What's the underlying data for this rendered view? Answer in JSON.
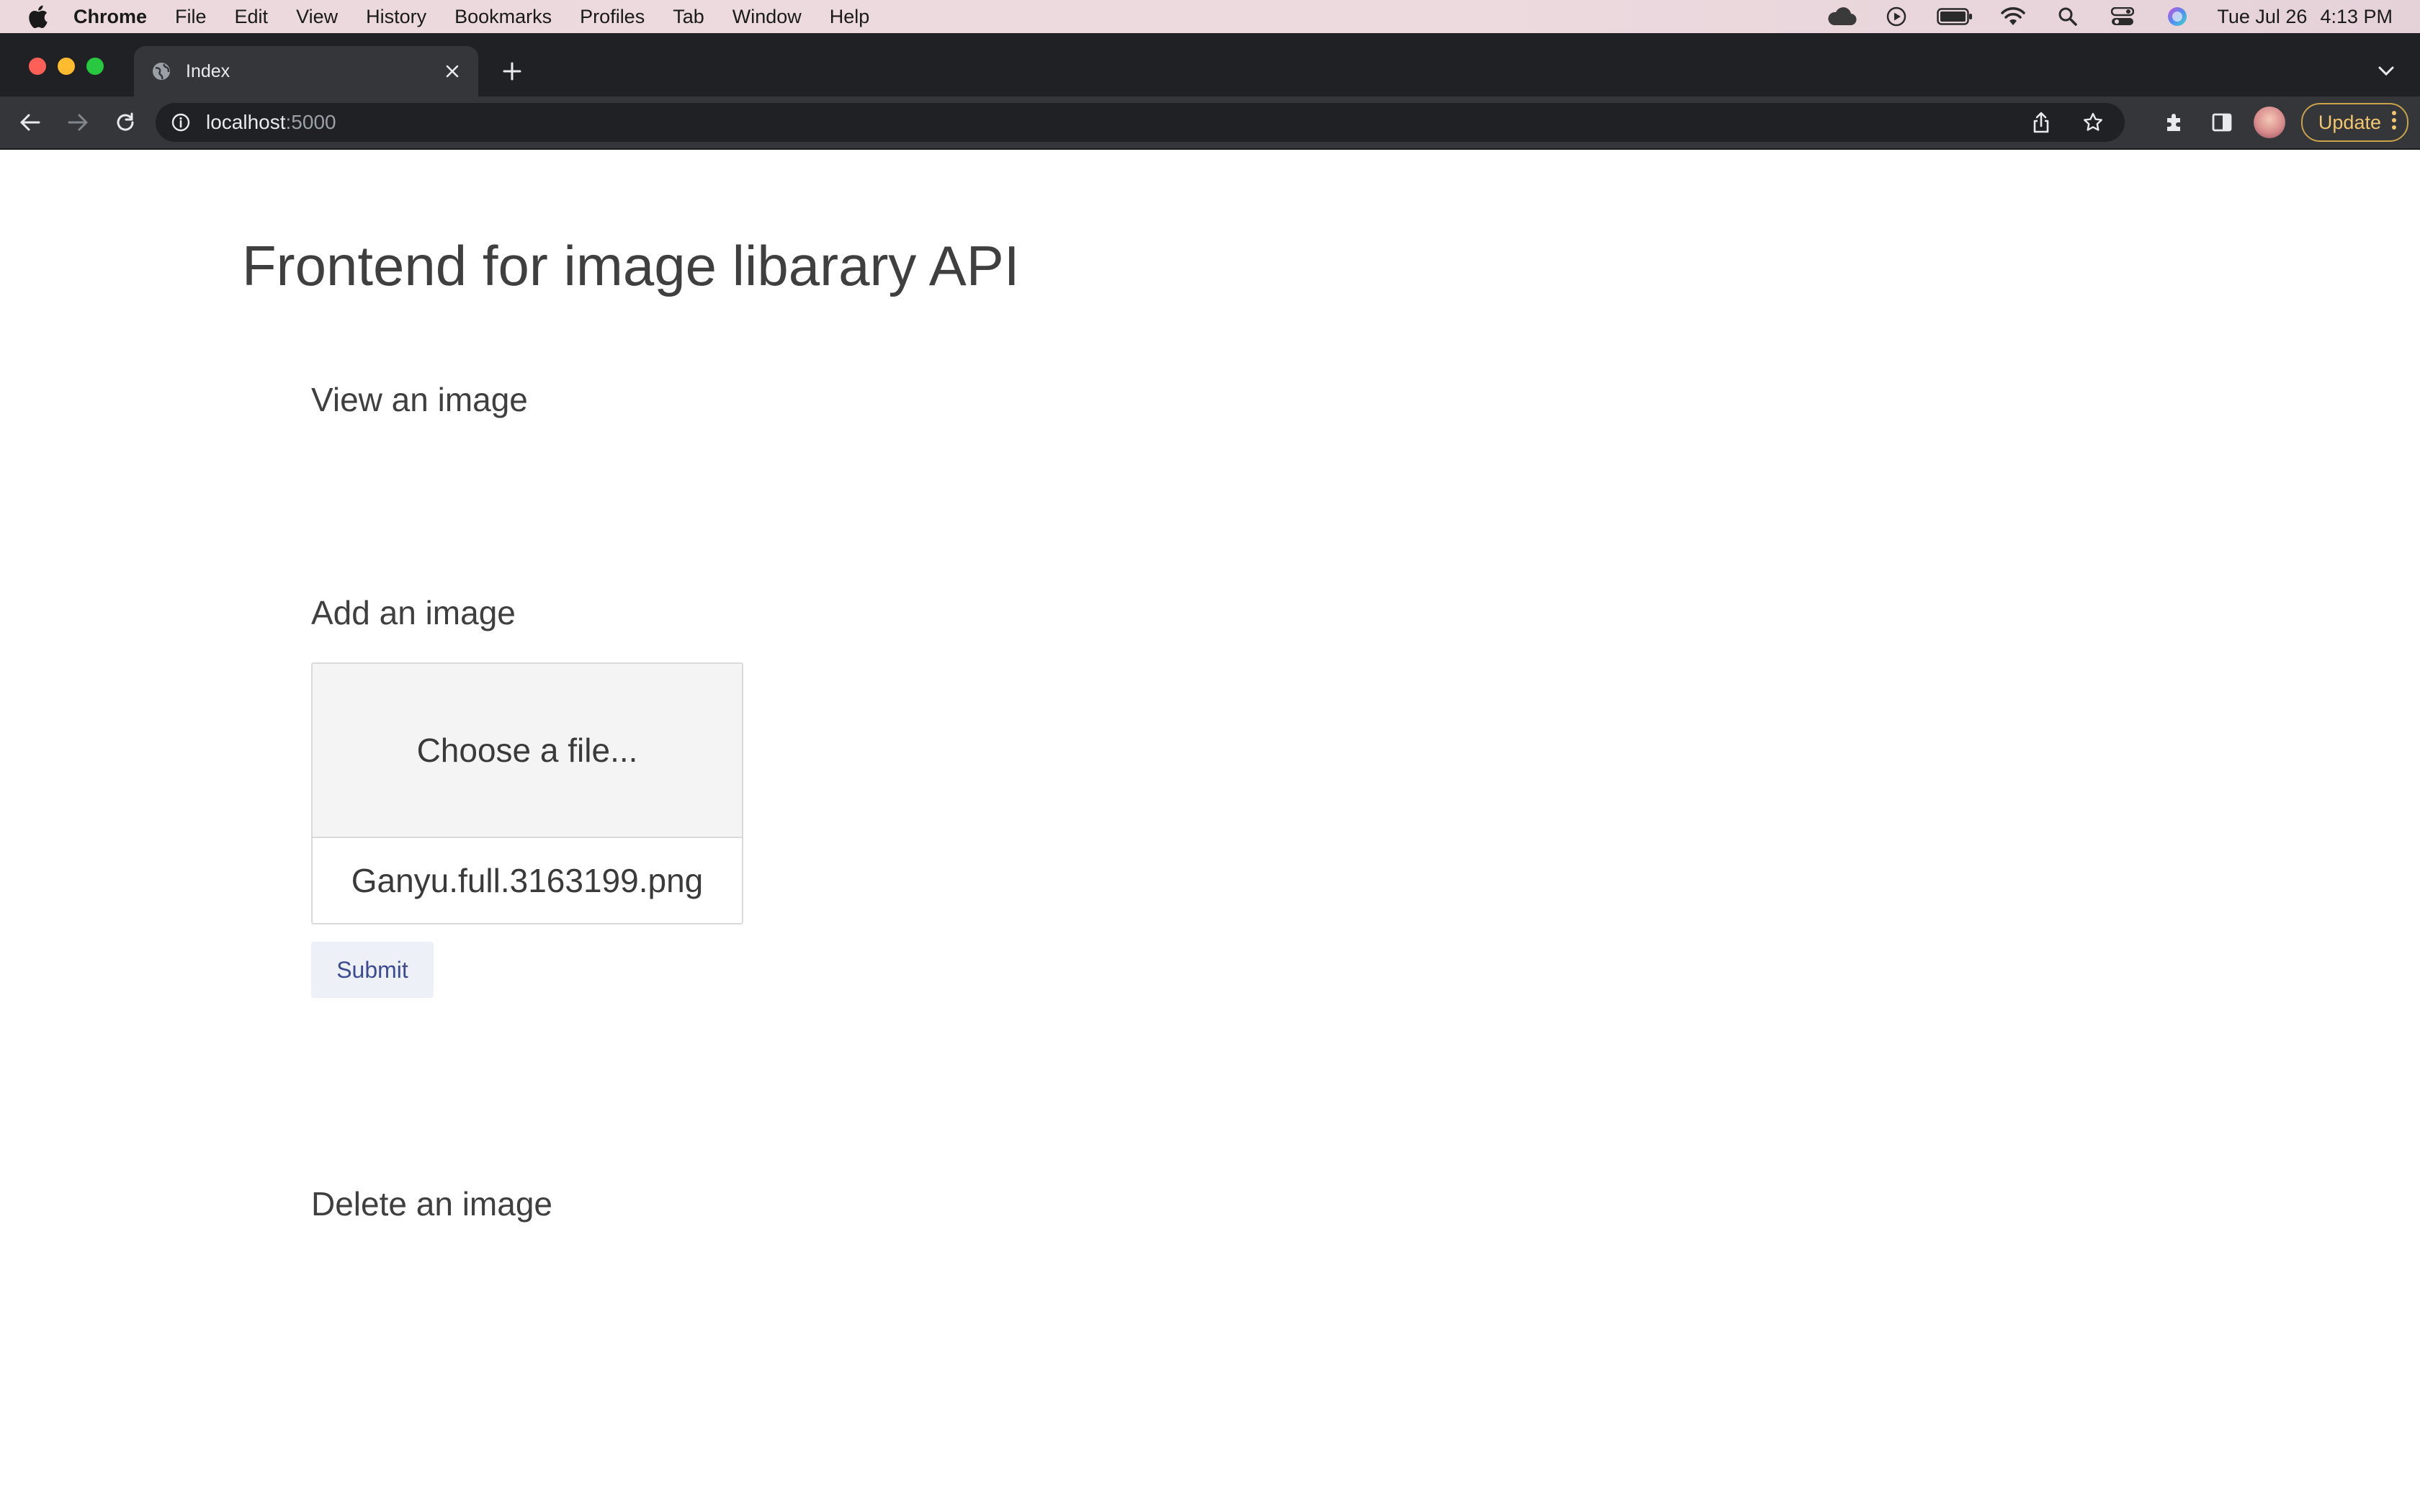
{
  "menubar": {
    "app_name": "Chrome",
    "items": [
      "File",
      "Edit",
      "View",
      "History",
      "Bookmarks",
      "Profiles",
      "Tab",
      "Window",
      "Help"
    ],
    "date": "Tue Jul 26",
    "time": "4:13 PM",
    "status_icons": [
      "cloud-icon",
      "play-icon",
      "battery-icon",
      "wifi-icon",
      "spotlight-search-icon",
      "control-center-icon",
      "siri-icon"
    ]
  },
  "browser": {
    "tab_title": "Index",
    "url_host": "localhost",
    "url_port": ":5000",
    "update_label": "Update"
  },
  "page": {
    "title": "Frontend for image libarary API",
    "view_heading": "View an image",
    "add_heading": "Add an image",
    "choose_file_label": "Choose a file...",
    "file_name": "Ganyu.full.3163199.png",
    "submit_label": "Submit",
    "delete_heading": "Delete an image"
  }
}
